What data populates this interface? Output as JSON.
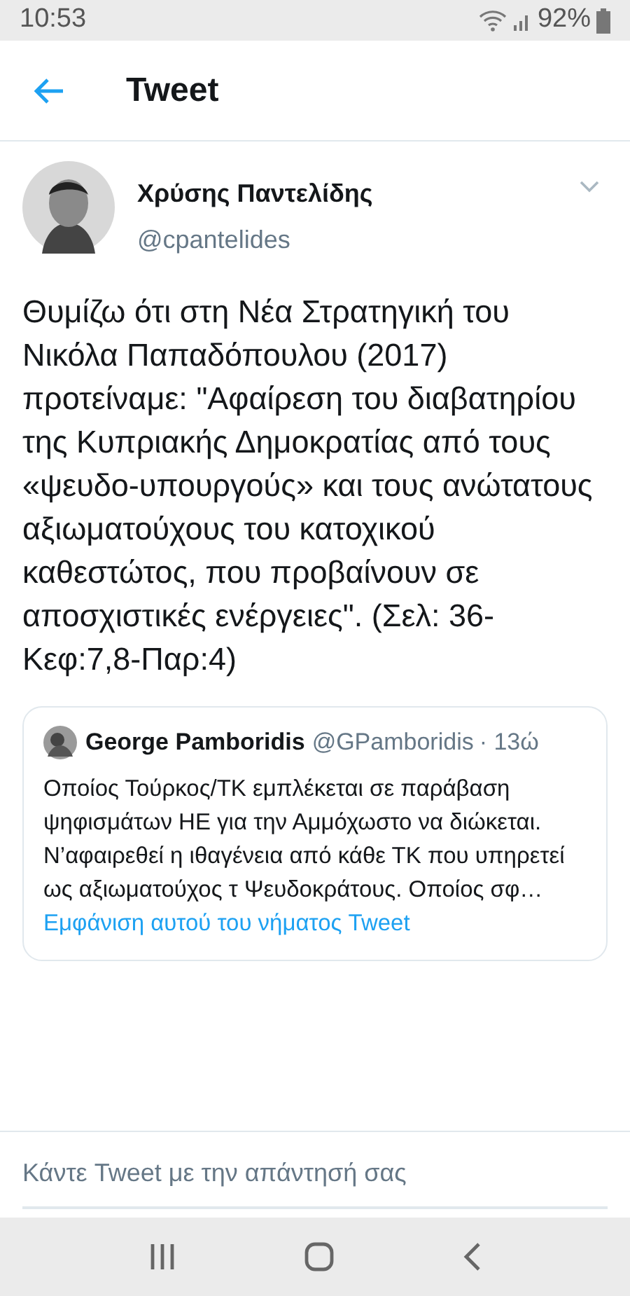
{
  "status_bar": {
    "time": "10:53",
    "battery": "92%"
  },
  "header": {
    "title": "Tweet"
  },
  "tweet": {
    "author": "Χρύσης Παντελίδης",
    "handle": "@cpantelides",
    "text": "Θυμίζω ότι στη Νέα Στρατηγική του Νικόλα Παπαδόπουλου (2017) προτείναμε: \"Αφαίρεση του διαβατηρίου της Κυπριακής Δημοκρατίας από τους «ψευδο-υπουργούς» και τους ανώτατους αξιωματούχους του κατοχικού καθεστώτος, που προβαίνουν σε αποσχιστικές ενέργειες\". (Σελ: 36-Κεφ:7,8-Παρ:4)",
    "quoted": {
      "author": "George Pamboridis",
      "handle": "@GPamboridis",
      "time": "· 13ώ",
      "text": "Οποίος Τούρκος/ΤΚ εμπλέκεται σε παράβαση ψηφισμάτων ΗΕ για την Αμμόχωστο να διώκεται. Ν’αφαιρεθεί η ιθαγένεια από κάθε ΤΚ που υπηρετεί ως αξιωματούχος τ Ψευδοκράτους. Οποίος σφ…",
      "link": "Εμφάνιση αυτού του νήματος Tweet"
    }
  },
  "reply": {
    "placeholder": "Κάντε Tweet με την απάντησή σας"
  }
}
